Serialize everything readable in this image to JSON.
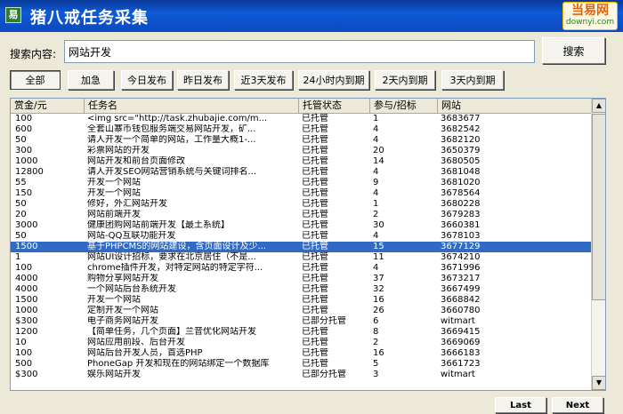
{
  "window": {
    "icon_glyph": "易",
    "title": "猪八戒任务采集",
    "watermark_main": "当易网",
    "watermark_sub": "downyi.com"
  },
  "search": {
    "label": "搜索内容:",
    "value": "网站开发",
    "button_label": "搜索"
  },
  "filters": [
    {
      "label": "全部",
      "selected": true
    },
    {
      "label": "加急"
    },
    {
      "label": "今日发布"
    },
    {
      "label": "昨日发布"
    },
    {
      "label": "近3天发布"
    },
    {
      "label": "24小时内到期"
    },
    {
      "label": "2天内到期"
    },
    {
      "label": "3天内到期"
    }
  ],
  "table": {
    "columns": [
      "赏金/元",
      "任务名",
      "托管状态",
      "参与/招标",
      "网站"
    ],
    "selected_row_index": 12,
    "rows": [
      [
        "100",
        "<img src=\"http://task.zhubajie.com/m...",
        "已托管",
        "1",
        "3683677"
      ],
      [
        "600",
        "全套山寨币钱包服务端交易网站开发，矿...",
        "已托管",
        "4",
        "3682542"
      ],
      [
        "50",
        "请人开发一个简单的网站，工作量大概1-...",
        "已托管",
        "4",
        "3682120"
      ],
      [
        "300",
        "彩票网站的开发",
        "已托管",
        "20",
        "3650379"
      ],
      [
        "1000",
        "网站开发和前台页面修改",
        "已托管",
        "14",
        "3680505"
      ],
      [
        "12800",
        "请人开发SEO网站营销系统与关键词排名...",
        "已托管",
        "4",
        "3681048"
      ],
      [
        "55",
        "开发一个网站",
        "已托管",
        "9",
        "3681020"
      ],
      [
        "150",
        "开发一个网站",
        "已托管",
        "4",
        "3678564"
      ],
      [
        "50",
        "修好，外汇网站开发",
        "已托管",
        "1",
        "3680228"
      ],
      [
        "20",
        "网站前端开发",
        "已托管",
        "2",
        "3679283"
      ],
      [
        "3000",
        "健康团购网站前端开发【最土系统】",
        "已托管",
        "30",
        "3660381"
      ],
      [
        "50",
        "网站-QQ互联功能开发",
        "已托管",
        "4",
        "3678103"
      ],
      [
        "1500",
        "基于PHPCMS的网站建设，含页面设计及少...",
        "已托管",
        "15",
        "3677129"
      ],
      [
        "1",
        "网站UI设计招标，要求在北京居住（不是...",
        "已托管",
        "11",
        "3674210"
      ],
      [
        "100",
        "chrome插件开发，对特定网站的特定字符...",
        "已托管",
        "4",
        "3671996"
      ],
      [
        "4000",
        "购物分享网站开发",
        "已托管",
        "37",
        "3673217"
      ],
      [
        "4000",
        "一个网站后台系统开发",
        "已托管",
        "32",
        "3667499"
      ],
      [
        "1500",
        "开发一个网站",
        "已托管",
        "16",
        "3668842"
      ],
      [
        "1000",
        "定制开发一个网站",
        "已托管",
        "26",
        "3660780"
      ],
      [
        "$300",
        "电子商务网站开发",
        "已部分托管",
        "6",
        "witmart"
      ],
      [
        "1200",
        "【简单任务，几个页面】兰音优化网站开发",
        "已托管",
        "8",
        "3669415"
      ],
      [
        "10",
        "网站应用前段、后台开发",
        "已托管",
        "2",
        "3669069"
      ],
      [
        "100",
        "网站后台开发人员，首选PHP",
        "已托管",
        "16",
        "3666183"
      ],
      [
        "500",
        "PhoneGap 开发和现在的网站绑定一个数据库",
        "已托管",
        "5",
        "3661723"
      ],
      [
        "$300",
        "娱乐网站开发",
        "已部分托管",
        "3",
        "witmart"
      ]
    ]
  },
  "pager": {
    "last_label": "Last",
    "next_label": "Next"
  }
}
